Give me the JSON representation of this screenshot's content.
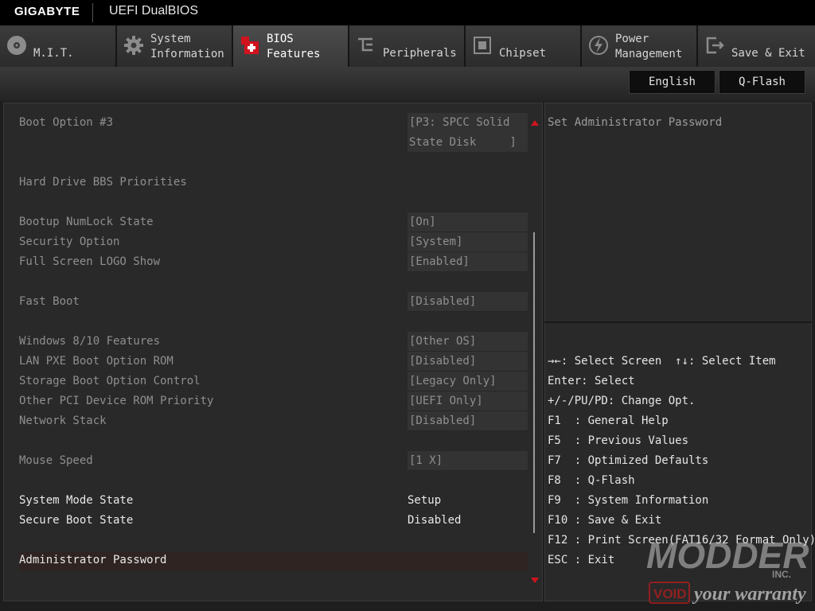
{
  "header": {
    "brand": "GIGABYTE",
    "product": "UEFI DualBIOS"
  },
  "tabs": [
    {
      "label": "M.I.T.",
      "icon": "disc-icon"
    },
    {
      "label": "System\nInformation",
      "icon": "gear-icon"
    },
    {
      "label": "BIOS\nFeatures",
      "icon": "bios-features-icon"
    },
    {
      "label": "Peripherals",
      "icon": "peripherals-icon"
    },
    {
      "label": "Chipset",
      "icon": "chipset-icon"
    },
    {
      "label": "Power\nManagement",
      "icon": "power-icon"
    },
    {
      "label": "Save & Exit",
      "icon": "exit-door-icon"
    }
  ],
  "active_tab": "BIOS Features",
  "buttons": {
    "language": "English",
    "qflash": "Q-Flash"
  },
  "settings": [
    {
      "label": "Boot Option #3",
      "value": "[P3: SPCC Solid\nState Disk     ]"
    },
    {
      "label": "Hard Drive BBS Priorities"
    },
    {
      "label": "Bootup NumLock State",
      "value": "[On]"
    },
    {
      "label": "Security Option",
      "value": "[System]"
    },
    {
      "label": "Full Screen LOGO Show",
      "value": "[Enabled]"
    },
    {
      "label": "Fast Boot",
      "value": "[Disabled]"
    },
    {
      "label": "Windows 8/10 Features",
      "value": "[Other OS]"
    },
    {
      "label": "LAN PXE Boot Option ROM",
      "value": "[Disabled]"
    },
    {
      "label": "Storage Boot Option Control",
      "value": "[Legacy Only]"
    },
    {
      "label": "Other PCI Device ROM Priority",
      "value": "[UEFI Only]"
    },
    {
      "label": "Network Stack",
      "value": "[Disabled]"
    },
    {
      "label": "Mouse Speed",
      "value": "[1 X]"
    },
    {
      "label": "System Mode State",
      "value": "Setup"
    },
    {
      "label": "Secure Boot State",
      "value": "Disabled"
    },
    {
      "label": "Administrator Password"
    }
  ],
  "help": {
    "description": "Set Administrator Password",
    "keys": [
      "→←: Select Screen  ↑↓: Select Item",
      "Enter: Select",
      "+/-/PU/PD: Change Opt.",
      "F1  : General Help",
      "F5  : Previous Values",
      "F7  : Optimized Defaults",
      "F8  : Q-Flash",
      "F9  : System Information",
      "F10 : Save & Exit",
      "F12 : Print Screen(FAT16/32 Format Only)",
      "ESC : Exit"
    ]
  },
  "watermark": {
    "line1": "MODDERS",
    "line2": "INC.",
    "void": "VOID",
    "tagline": "your warranty"
  },
  "colors": {
    "accent": "#d0141e",
    "selected_row": "#2f2422",
    "background": "#1e1e1f"
  }
}
